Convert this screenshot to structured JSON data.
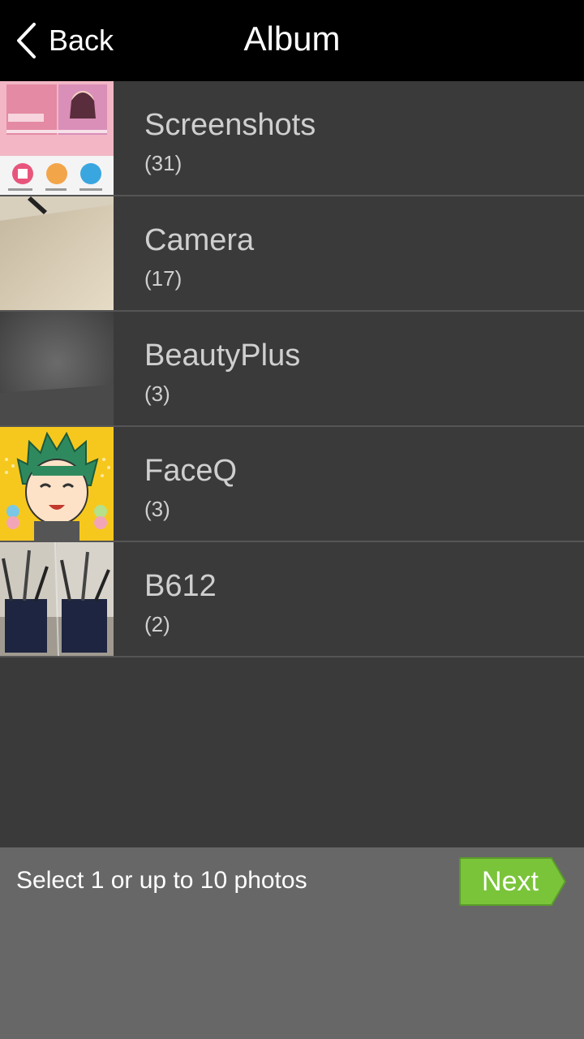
{
  "header": {
    "back_label": "Back",
    "title": "Album"
  },
  "albums": [
    {
      "name": "Screenshots",
      "count": "(31)",
      "thumb": "screenshot-thumbnail"
    },
    {
      "name": "Camera",
      "count": "(17)",
      "thumb": "camera-thumbnail"
    },
    {
      "name": "BeautyPlus",
      "count": "(3)",
      "thumb": "beautyplus-thumbnail"
    },
    {
      "name": "FaceQ",
      "count": "(3)",
      "thumb": "faceq-cartoon-thumbnail"
    },
    {
      "name": "B612",
      "count": "(2)",
      "thumb": "b612-desk-thumbnail"
    }
  ],
  "footer": {
    "hint": "Select 1 or up to 10 photos",
    "next_label": "Next"
  },
  "colors": {
    "nav_bg": "#000000",
    "list_bg": "#3a3a3a",
    "footer_bg": "#676767",
    "next_green": "#7ac43a"
  }
}
